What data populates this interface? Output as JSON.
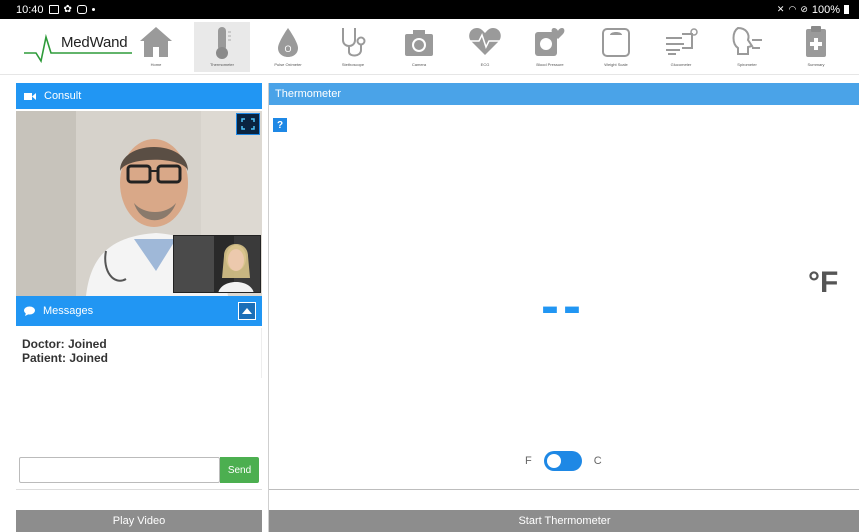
{
  "status_bar": {
    "time": "10:40",
    "battery": "100%"
  },
  "app": {
    "logo": "MedWand"
  },
  "nav": {
    "items": [
      {
        "label": "Home",
        "icon": "home-icon"
      },
      {
        "label": "Thermometer",
        "icon": "thermometer-icon",
        "active": true
      },
      {
        "label": "Pulse Oximeter",
        "icon": "pulse-oximeter-icon"
      },
      {
        "label": "Stethoscope",
        "icon": "stethoscope-icon"
      },
      {
        "label": "Camera",
        "icon": "camera-icon"
      },
      {
        "label": "ECG",
        "icon": "ecg-icon"
      },
      {
        "label": "Blood Pressure",
        "icon": "blood-pressure-icon"
      },
      {
        "label": "Weight Scale",
        "icon": "weight-scale-icon"
      },
      {
        "label": "Glucometer",
        "icon": "glucometer-icon"
      },
      {
        "label": "Spirometer",
        "icon": "spirometer-icon"
      },
      {
        "label": "Summary",
        "icon": "summary-icon"
      }
    ]
  },
  "consult": {
    "title": "Consult"
  },
  "messages": {
    "title": "Messages",
    "lines": [
      "Doctor: Joined",
      "Patient: Joined"
    ],
    "input_placeholder": "",
    "send_label": "Send"
  },
  "left_footer": {
    "play_video_label": "Play Video"
  },
  "thermometer": {
    "title": "Thermometer",
    "help_label": "?",
    "reading": "--",
    "unit": "°F",
    "toggle_left": "F",
    "toggle_right": "C",
    "start_label": "Start Thermometer"
  },
  "colors": {
    "primary": "#2196f3",
    "header_bar": "#4aa3e8",
    "send": "#4caf50",
    "footer_button": "#8d8d8d"
  }
}
